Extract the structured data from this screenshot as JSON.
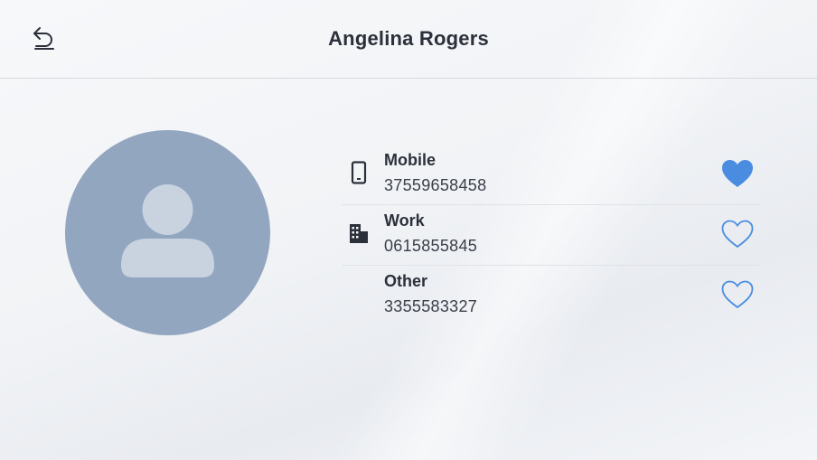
{
  "header": {
    "title": "Angelina Rogers",
    "back_icon": "back-arrow-icon"
  },
  "avatar": {
    "icon": "person-placeholder-icon",
    "background": "#92a6c0"
  },
  "phones": [
    {
      "label": "Mobile",
      "number": "37559658458",
      "icon": "mobile-phone-icon",
      "favorite": true
    },
    {
      "label": "Work",
      "number": "0615855845",
      "icon": "building-icon",
      "favorite": false
    },
    {
      "label": "Other",
      "number": "3355583327",
      "icon": "",
      "favorite": false
    }
  ],
  "colors": {
    "accent": "#4a8de0",
    "text": "#2b303a"
  }
}
